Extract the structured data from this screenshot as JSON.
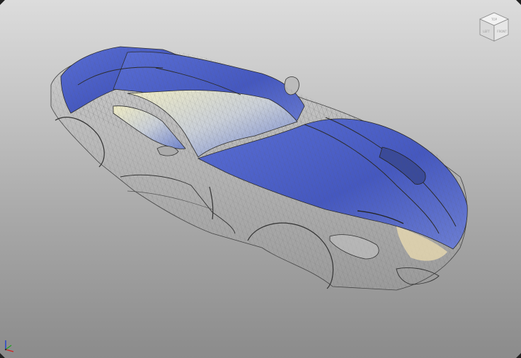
{
  "viewport": {
    "background_top": "#dcdcdc",
    "background_bottom": "#8b8b8b"
  },
  "viewcube": {
    "top_face_label": "TOP",
    "left_face_label": "LEFT",
    "front_face_label": "FRONT"
  },
  "model": {
    "surface_color": "#4a5fc8",
    "highlight_color": "#e9e6bf",
    "wireframe_color": "#3a3a3a"
  },
  "triad": {
    "x_color": "#d02020",
    "y_color": "#20a020",
    "z_color": "#2040d0"
  }
}
